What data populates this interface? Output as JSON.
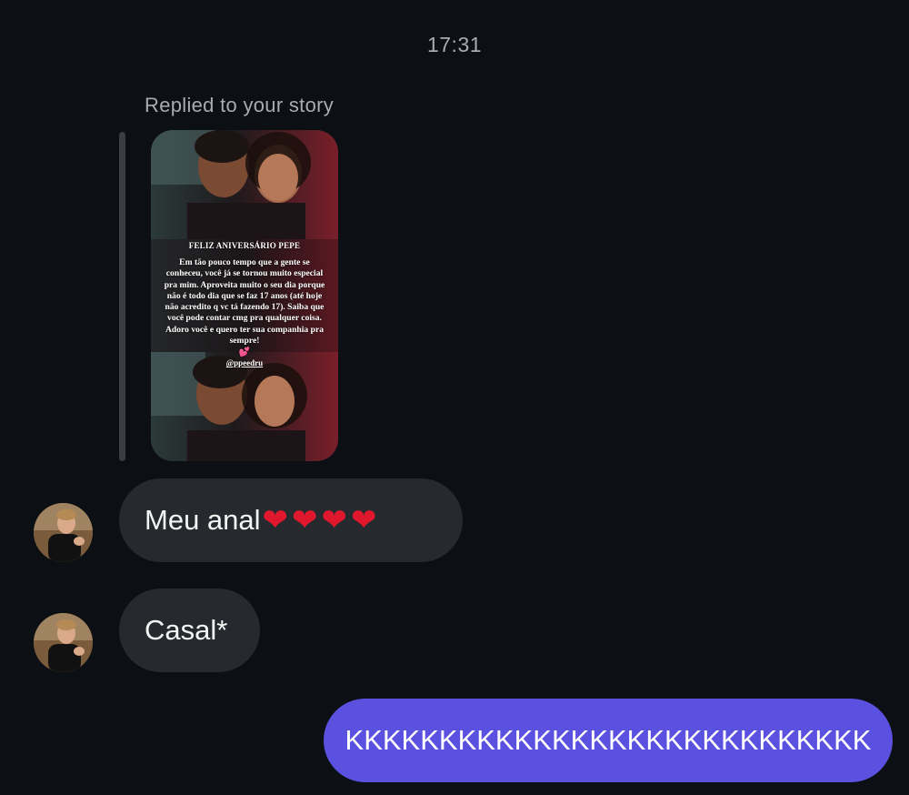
{
  "timestamp": "17:31",
  "reply": {
    "label": "Replied to your story",
    "story": {
      "title": "FELIZ ANIVERSÁRIO PEPE",
      "body": "Em tão pouco tempo que a gente se conheceu, você já se tornou muito especial pra mim. Aproveita muito o seu dia porque não é todo dia que se faz 17 anos (até hoje não acredito q vc tá fazendo 17). Saiba que você pode contar cmg pra qualquer coisa. Adoro você e quero ter sua companhia pra sempre!",
      "emoji": "💕",
      "handle": "@ppeedru"
    }
  },
  "messages": [
    {
      "side": "incoming",
      "text": "Meu anal",
      "emoji": "❤❤❤❤"
    },
    {
      "side": "incoming",
      "text": "Casal*"
    },
    {
      "side": "outgoing",
      "text": "KKKKKKKKKKKKKKKKKKKKKKKKKKKK"
    }
  ],
  "colors": {
    "background": "#0c1014",
    "incoming_bubble": "#26292e",
    "outgoing_bubble": "#5b51e0",
    "muted_text": "#a8abb0",
    "heart": "#e0182d"
  }
}
